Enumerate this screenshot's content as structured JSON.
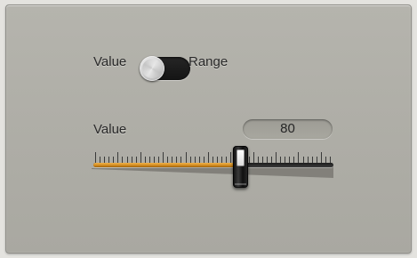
{
  "mode_toggle": {
    "left_label": "Value",
    "right_label": "Range",
    "selected": "Value"
  },
  "value_slider": {
    "label": "Value",
    "display_value": "80",
    "value": 80,
    "fill_fraction": 0.61,
    "tick_count": 53,
    "major_tick_every": 5,
    "fill_color": "#d08a1e",
    "track_color": "#2a2a2a"
  }
}
